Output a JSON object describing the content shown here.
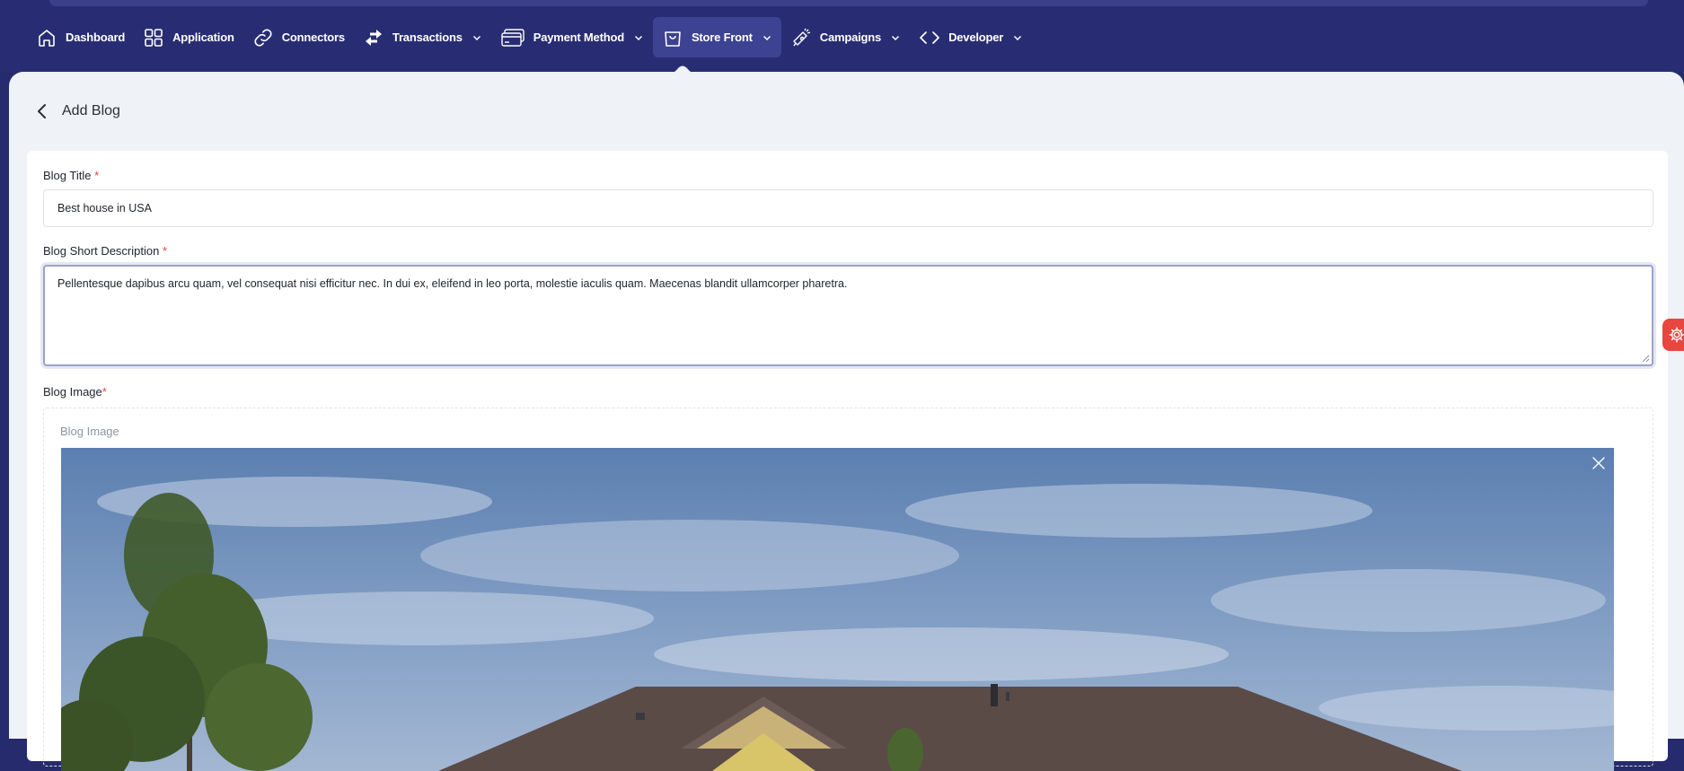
{
  "nav": {
    "items": [
      {
        "label": "Dashboard",
        "icon": "home-icon"
      },
      {
        "label": "Application",
        "icon": "grid-icon"
      },
      {
        "label": "Connectors",
        "icon": "link-icon"
      },
      {
        "label": "Transactions",
        "icon": "swap-arrows-icon"
      },
      {
        "label": "Payment Method",
        "icon": "credit-card-icon"
      },
      {
        "label": "Store Front",
        "icon": "shopping-bag-icon",
        "active": true
      },
      {
        "label": "Campaigns",
        "icon": "megaphone-icon"
      },
      {
        "label": "Developer",
        "icon": "code-icon"
      }
    ]
  },
  "page": {
    "title": "Add Blog"
  },
  "form": {
    "title_label": "Blog Title",
    "title_value": "Best house in USA",
    "short_desc_label": "Blog Short Description",
    "short_desc_value": "Pellentesque dapibus arcu quam, vel consequat nisi efficitur nec. In dui ex, eleifend in leo porta, molestie iaculis quam. Maecenas blandit ullamcorper pharetra.",
    "image_label": "Blog Image",
    "image_dropzone_label": "Blog Image",
    "required_mark": "*"
  },
  "colors": {
    "nav_bg": "#282d73",
    "nav_active": "#3d4292",
    "page_bg": "#eff2f7",
    "required": "#e04545",
    "settings_fab": "#e9463f"
  }
}
